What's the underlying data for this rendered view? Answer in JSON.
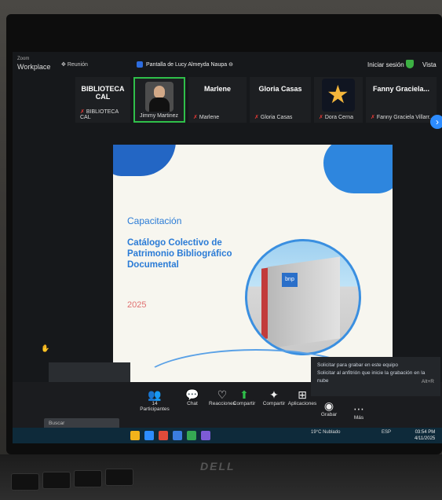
{
  "topbar": {
    "app_name": "Zoom",
    "app_sub": "Workplace",
    "meeting_label": "Reunión",
    "share_title": "Pantalla de Lucy Almeyda Naupa",
    "signin": "Iniciar sesión",
    "view": "Vista"
  },
  "participants": [
    {
      "big": "BIBLIOTECA CAL",
      "small": "BIBLIOTECA CAL",
      "type": "name"
    },
    {
      "big": "",
      "small": "Jimmy Martinez",
      "type": "video",
      "active": true
    },
    {
      "big": "Marlene",
      "small": "Marlene",
      "type": "name"
    },
    {
      "big": "Gloria Casas",
      "small": "Gloria Casas",
      "type": "name"
    },
    {
      "big": "",
      "small": "Dora Cerna",
      "type": "star"
    },
    {
      "big": "Fanny Graciela...",
      "small": "Fanny Graciela Villarr...",
      "type": "name"
    }
  ],
  "slide": {
    "title": "Capacitación",
    "subtitle": "Catálogo Colectivo de Patrimonio Bibliográfico Documental",
    "year": "2025",
    "building_logo": "bnp"
  },
  "toolbar": {
    "participants_label": "Participantes",
    "participants_count": "14",
    "chat_label": "Chat",
    "reactions_label": "Reacciones",
    "share_label": "Compartir",
    "share_screen_label": "Compartir",
    "apps_label": "Aplicaciones",
    "record_label": "Grabar",
    "more_label": "Más",
    "search_placeholder": "Buscar"
  },
  "tooltip": {
    "line1": "Solicitar para grabar en este equipo",
    "line2": "Solicitar al anfitrión que inicie la grabación en la nube",
    "shortcut": "Alt+R"
  },
  "taskbar": {
    "weather": "19°C  Nublado",
    "lang": "ESP",
    "time": "03:54 PM",
    "date": "4/11/2025"
  },
  "hardware": {
    "brand": "DELL"
  },
  "colors": {
    "zoom_blue": "#2d8cff",
    "active_green": "#2fbf4a",
    "slide_blue": "#2a7bd6",
    "slide_year": "#e07070"
  }
}
